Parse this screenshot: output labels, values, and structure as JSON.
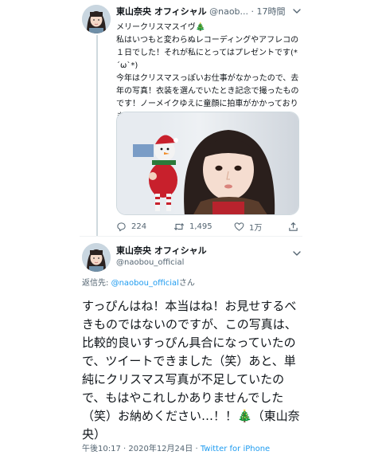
{
  "tweet1": {
    "display_name": "東山奈央 オフィシャル",
    "handle": "@naob...",
    "dot": "·",
    "time": "17時間",
    "text": "メリークリスマスイヴ🎄\n私はいつもと変わらぬレコーディングやアフレコの１日でした！それが私にとってはプレゼントです(*´ω`*)\n今年はクリスマスっぽいお仕事がなかったので、去年の写真！衣装を選んでいたとき記念で撮ったものです！ノーメイクゆえに童顔に拍車がかかっております…！（東山奈央）",
    "stats": {
      "replies": "224",
      "retweets": "1,495",
      "likes": "1万"
    }
  },
  "tweet2": {
    "display_name": "東山奈央 オフィシャル",
    "handle": "@naobou_official",
    "reply_prefix": "返信先: ",
    "reply_handle": "@naobou_official",
    "reply_suffix": "さん",
    "text": "すっぴんはね！本当はね！お見せするべきものではないのですが、この写真は、比較的良いすっぴん具合になっていたので、ツイートできました（笑）あと、単純にクリスマス写真が不足していたので、もはやこれしかありませんでした（笑）お納めください…！！🎄（東山奈央）",
    "time": "午後10:17",
    "date_sep": " · ",
    "date": "2020年12月24日",
    "source_sep": " · ",
    "source": "Twitter for iPhone"
  },
  "icons": {
    "reply": "reply-icon",
    "retweet": "retweet-icon",
    "like": "heart-icon",
    "share": "share-icon",
    "more": "chevron-down-icon"
  },
  "colors": {
    "link": "#1d9bf0",
    "secondary_text": "#536471",
    "thread_line": "#cfd9de"
  }
}
